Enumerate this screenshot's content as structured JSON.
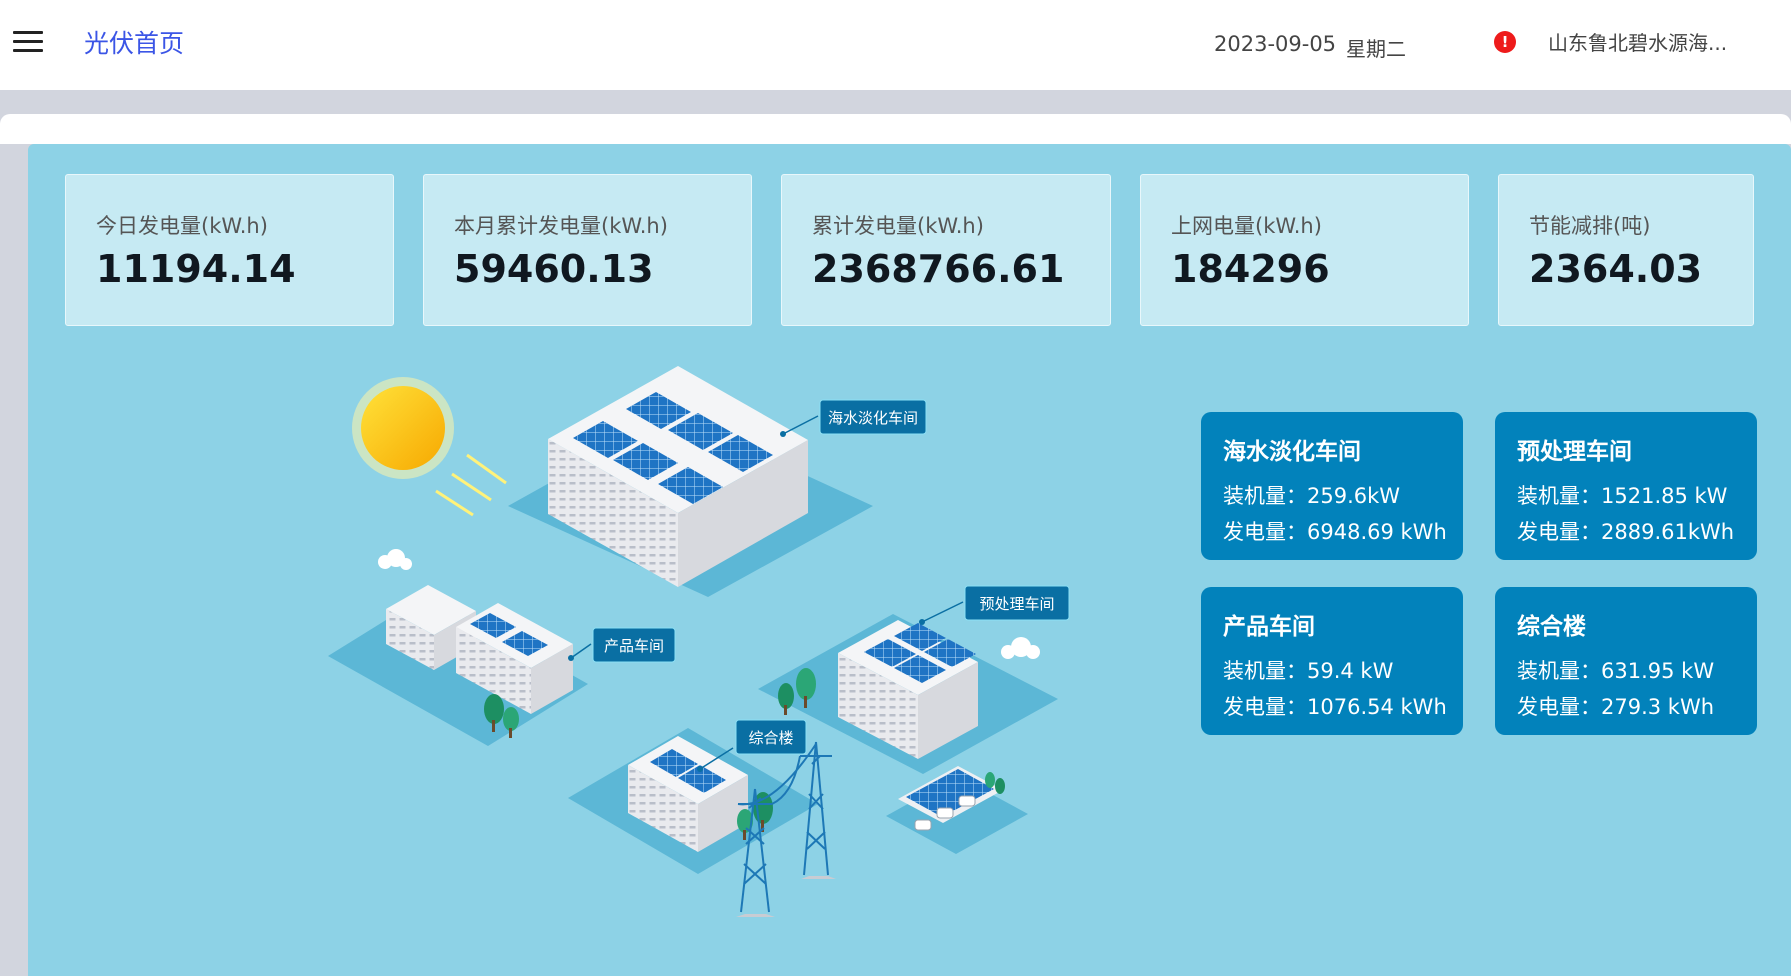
{
  "header": {
    "page_title": "光伏首页",
    "date": "2023-09-05",
    "weekday": "星期二",
    "org_name": "山东鲁北碧水源海...",
    "alert_icon": "exclamation-circle-icon",
    "alert_color": "#ee1b1b",
    "accent_color": "#3b55e6"
  },
  "stats": [
    {
      "label": "今日发电量(kW.h)",
      "value": "11194.14"
    },
    {
      "label": "本月累计发电量(kW.h)",
      "value": "59460.13"
    },
    {
      "label": "累计发电量(kW.h)",
      "value": "2368766.61"
    },
    {
      "label": "上网电量(kW.h)",
      "value": "184296"
    },
    {
      "label": "节能减排(吨)",
      "value": "2364.03"
    }
  ],
  "workshops": [
    {
      "name": "海水淡化车间",
      "capacity": "装机量：259.6kW",
      "generation": "发电量：6948.69 kWh"
    },
    {
      "name": "预处理车间",
      "capacity": "装机量：1521.85 kW",
      "generation": "发电量：2889.61kWh"
    },
    {
      "name": "产品车间",
      "capacity": "装机量：59.4 kW",
      "generation": "发电量：1076.54 kWh"
    },
    {
      "name": "综合楼",
      "capacity": "装机量：631.95 kW",
      "generation": "发电量：279.3 kWh"
    }
  ],
  "scene_labels": {
    "desalination": "海水淡化车间",
    "pretreatment": "预处理车间",
    "product": "产品车间",
    "complex": "综合楼"
  },
  "colors": {
    "panel_bg": "#8dd2e6",
    "stat_card_bg": "#c6eaf3",
    "workshop_card_bg": "#0282bb",
    "scene_tag_bg": "#0a6fa3"
  }
}
